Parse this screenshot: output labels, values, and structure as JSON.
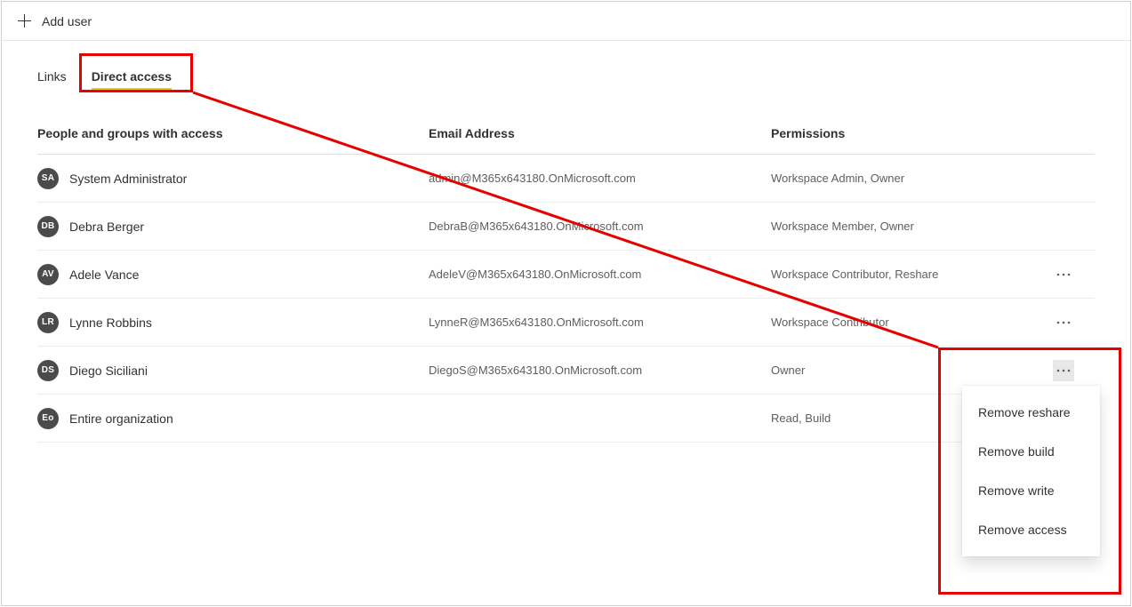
{
  "cmdbar": {
    "add_user_label": "Add user"
  },
  "tabs": {
    "links_label": "Links",
    "direct_access_label": "Direct access"
  },
  "headers": {
    "people": "People and groups with access",
    "email": "Email Address",
    "permissions": "Permissions"
  },
  "rows": [
    {
      "initials": "SA",
      "name": "System Administrator",
      "email": "admin@M365x643180.OnMicrosoft.com",
      "permissions": "Workspace Admin, Owner",
      "actions": false
    },
    {
      "initials": "DB",
      "name": "Debra Berger",
      "email": "DebraB@M365x643180.OnMicrosoft.com",
      "permissions": "Workspace Member, Owner",
      "actions": false
    },
    {
      "initials": "AV",
      "name": "Adele Vance",
      "email": "AdeleV@M365x643180.OnMicrosoft.com",
      "permissions": "Workspace Contributor, Reshare",
      "actions": true
    },
    {
      "initials": "LR",
      "name": "Lynne Robbins",
      "email": "LynneR@M365x643180.OnMicrosoft.com",
      "permissions": "Workspace Contributor",
      "actions": true
    },
    {
      "initials": "DS",
      "name": "Diego Siciliani",
      "email": "DiegoS@M365x643180.OnMicrosoft.com",
      "permissions": "Owner",
      "actions": true,
      "active": true
    },
    {
      "initials": "Eo",
      "name": "Entire organization",
      "email": "",
      "permissions": "Read, Build",
      "actions": false
    }
  ],
  "menu": {
    "remove_reshare": "Remove reshare",
    "remove_build": "Remove build",
    "remove_write": "Remove write",
    "remove_access": "Remove access"
  }
}
